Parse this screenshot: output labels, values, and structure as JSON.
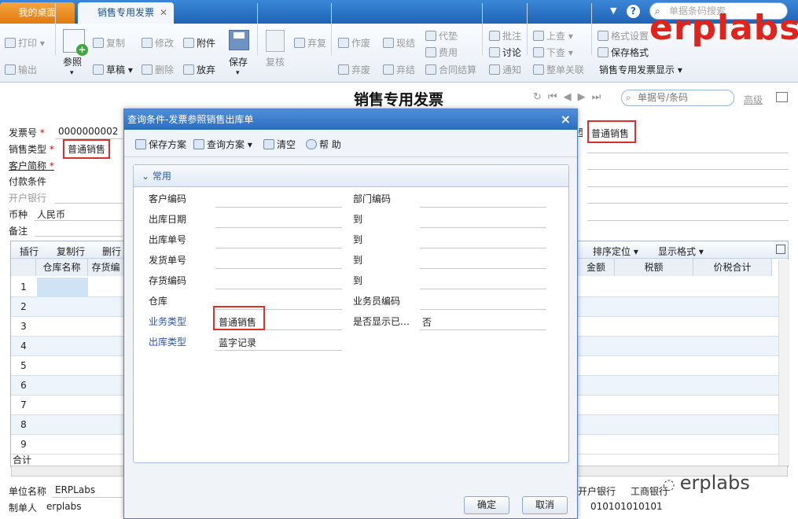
{
  "tabs": {
    "home": "我的桌面",
    "invoice": "销售专用发票"
  },
  "top_search_placeholder": "单据条码搜索",
  "toolbar": {
    "print": "打印",
    "export": "输出",
    "copy": "复制",
    "draft": "草稿",
    "modify": "修改",
    "delete": "删除",
    "attach": "附件",
    "discard": "放弃",
    "save": "保存",
    "ref": "参照",
    "review": "复核",
    "abandon_review": "弃复",
    "void": "作废",
    "abandon_void": "弃废",
    "cash_settle": "现结",
    "abandon_settle": "弃结",
    "advance": "代垫",
    "expense": "费用",
    "contract_settle": "合同结算",
    "annotate": "批注",
    "discuss": "讨论",
    "notify": "通知",
    "prev": "上查",
    "next": "下查",
    "doc_link": "整单关联",
    "format_settings": "格式设置",
    "save_format": "保存格式",
    "display_format": "销售专用发票显示"
  },
  "logo": "erplabs",
  "page_title": "销售专用发票",
  "doc_search_placeholder": "单据号/条码",
  "advanced": "高级",
  "form": {
    "invoice_no_label": "发票号",
    "invoice_no": "0000000002",
    "sales_type_label": "销售类型",
    "sales_type": "普通销售",
    "customer_label": "客户简称",
    "payment_label": "付款条件",
    "bank_label": "开户银行",
    "currency_label": "币种",
    "currency": "人民币",
    "remark_label": "备注",
    "right_type": "普通销售",
    "unit_label": "单位名称",
    "unit": "ERPLabs",
    "maker_label": "制单人",
    "maker": "erplabs",
    "open_bank_label": "开户银行",
    "open_bank": "工商银行",
    "account": "010101010101"
  },
  "grid": {
    "actions": [
      "插行",
      "复制行",
      "删行",
      "排序定位",
      "显示格式"
    ],
    "headers_left": [
      "仓库名称",
      "存货编"
    ],
    "headers_right": [
      "金额",
      "税额",
      "价税合计"
    ],
    "rows": [
      "1",
      "2",
      "3",
      "4",
      "5",
      "6",
      "7",
      "8",
      "9"
    ],
    "total": "合计"
  },
  "modal": {
    "title": "查询条件-发票参照销售出库单",
    "toolbar": [
      "保存方案",
      "查询方案",
      "清空",
      "帮 助"
    ],
    "section": "常用",
    "left_labels": [
      "客户编码",
      "出库日期",
      "出库单号",
      "发货单号",
      "存货编码",
      "仓库",
      "业务类型",
      "出库类型"
    ],
    "right_labels": [
      "部门编码",
      "到",
      "到",
      "到",
      "到",
      "业务员编码",
      "是否显示已…"
    ],
    "business_type": "普通销售",
    "out_type": "蓝字记录",
    "show_done": "否",
    "ok": "确定",
    "cancel": "取消"
  },
  "watermark": "erplabs"
}
